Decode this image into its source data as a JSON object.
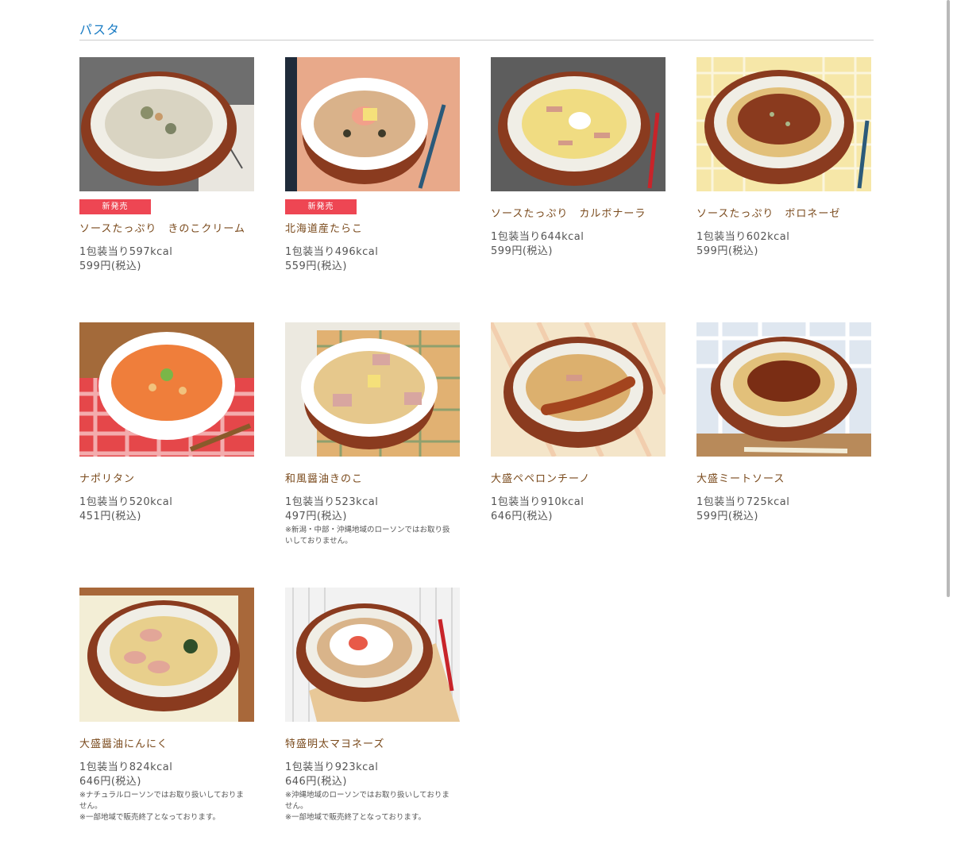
{
  "section": {
    "title": "パスタ"
  },
  "products": [
    {
      "badge": "新発売",
      "name": "ソースたっぷり　きのこクリーム",
      "kcal": "1包装当り597kcal",
      "price": "599円(税込)",
      "notes": []
    },
    {
      "badge": "新発売",
      "name": "北海道産たらこ",
      "kcal": "1包装当り496kcal",
      "price": "559円(税込)",
      "notes": []
    },
    {
      "badge": "",
      "name": "ソースたっぷり　カルボナーラ",
      "kcal": "1包装当り644kcal",
      "price": "599円(税込)",
      "notes": []
    },
    {
      "badge": "",
      "name": "ソースたっぷり　ボロネーゼ",
      "kcal": "1包装当り602kcal",
      "price": "599円(税込)",
      "notes": []
    },
    {
      "badge": "",
      "name": "ナポリタン",
      "kcal": "1包装当り520kcal",
      "price": "451円(税込)",
      "notes": []
    },
    {
      "badge": "",
      "name": "和風醤油きのこ",
      "kcal": "1包装当り523kcal",
      "price": "497円(税込)",
      "notes": [
        "※新潟・中部・沖縄地域のローソンではお取り扱いしておりません。"
      ]
    },
    {
      "badge": "",
      "name": "大盛ペペロンチーノ",
      "kcal": "1包装当り910kcal",
      "price": "646円(税込)",
      "notes": []
    },
    {
      "badge": "",
      "name": "大盛ミートソース",
      "kcal": "1包装当り725kcal",
      "price": "599円(税込)",
      "notes": []
    },
    {
      "badge": "",
      "name": "大盛醤油にんにく",
      "kcal": "1包装当り824kcal",
      "price": "646円(税込)",
      "notes": [
        "※ナチュラルローソンではお取り扱いしておりません。",
        "※一部地域で販売終了となっております。"
      ]
    },
    {
      "badge": "",
      "name": "特盛明太マヨネーズ",
      "kcal": "1包装当り923kcal",
      "price": "646円(税込)",
      "notes": [
        "※沖縄地域のローソンではお取り扱いしておりません。",
        "※一部地域で販売終了となっております。"
      ]
    }
  ],
  "colors": {
    "title": "#1a7cc4",
    "badge": "#ee4653",
    "name": "#7a4a1c",
    "text": "#555555"
  },
  "icons": {
    "product_photo": "pasta-bowl-photo"
  }
}
